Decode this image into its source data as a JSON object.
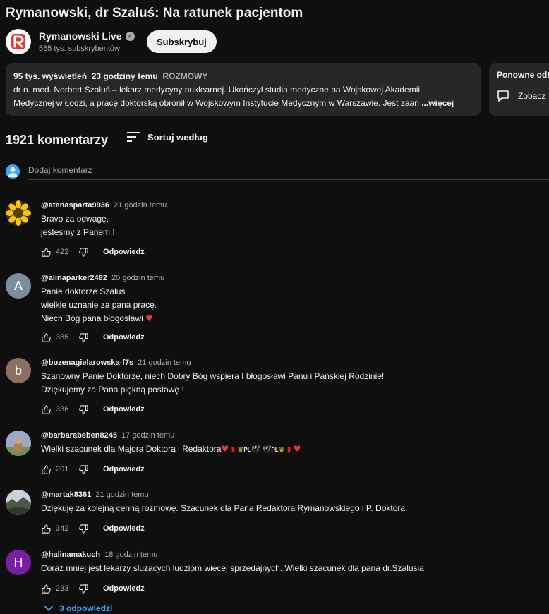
{
  "video": {
    "title": "Rymanowski, dr Szaluś: Na ratunek pacjentom"
  },
  "channel": {
    "name": "Rymanowski Live",
    "subscribers": "565 tys. subskrybentów",
    "subscribe_label": "Subskrybuj"
  },
  "description": {
    "views": "95 tys. wyświetleń",
    "age": "23 godziny temu",
    "tag": "ROZMOWY",
    "line1": "dr n. med. Norbert Szaluś – lekarz medycyny nuklearnej. Ukończył studia medyczne na Wojskowej Akademii",
    "line2": "Medycznej w Łodzi, a pracę doktorską obronił w Wojskowym Instytucie Medycznym w Warszawie. Jest zaan",
    "more": "...więcej"
  },
  "replay": {
    "title": "Ponowne odtwarzanie",
    "button": "Zobacz"
  },
  "comments_header": {
    "count": "1921 komentarzy",
    "sort_label": "Sortuj według"
  },
  "add_comment": {
    "placeholder": "Dodaj komentarz"
  },
  "reply_label": "Odpowiedz",
  "comments": [
    {
      "author": "@atenasparta9936",
      "time": "21 godzin temu",
      "lines": [
        "Bravo  za odwagę,",
        "jesteśmy z Panem !"
      ],
      "likes": "422",
      "avatar": {
        "type": "image",
        "icon": "sunflower-icon",
        "color": "#f5c518"
      }
    },
    {
      "author": "@alinaparker2482",
      "time": "20 godzin temu",
      "lines": [
        "Panie doktorze Szalus",
        "wielkie uznanie za pana pracę.",
        "Niech Bóg pana błogosławi"
      ],
      "likes": "385",
      "avatar": {
        "type": "letter",
        "letter": "A",
        "color": "#78909c"
      }
    },
    {
      "author": "@bozenagielarowska-f7s",
      "time": "21 godzin temu",
      "lines": [
        "Szanowny Panie Doktorze, niech Dobry Bóg wspiera I błogosławi Panu i Pańskiej Rodzinie!",
        "Dziękujemy za Pana piękną postawę !"
      ],
      "likes": "336",
      "avatar": {
        "type": "letter",
        "letter": "b",
        "color": "#8d6e63"
      }
    },
    {
      "author": "@barbarabeben8245",
      "time": "17 godzin temu",
      "lines": [
        "Wielki szacunek dla Majora Doktora i Redaktora"
      ],
      "likes": "201",
      "avatar": {
        "type": "image",
        "icon": "cat-photo-icon",
        "color": "#9aa7c8"
      }
    },
    {
      "author": "@martak8361",
      "time": "21 godzin temu",
      "lines": [
        "Dziękuję za kolejną cenną rozmowę. Szacunek dla Pana Redaktora Rymanowskiego i P. Doktora."
      ],
      "likes": "342",
      "avatar": {
        "type": "image",
        "icon": "landscape-photo-icon",
        "color": "#5c6b5a"
      }
    },
    {
      "author": "@halinamakuch",
      "time": "18 godzin temu",
      "lines": [
        "Coraz mniej jest lekarzy sluzacych ludziom wiecej sprzedajnych. Wielki  szacunek  dla pana dr.Szalusia"
      ],
      "likes": "233",
      "avatar": {
        "type": "letter",
        "letter": "H",
        "color": "#7b1fa2"
      }
    }
  ],
  "emoji_row": {
    "pl_label": "PL"
  },
  "replies_toggle": "3 odpowiedzi",
  "colors": {
    "background": "#0f0f0f",
    "link_blue": "#3ea6ff",
    "heart_red": "#e53935"
  }
}
